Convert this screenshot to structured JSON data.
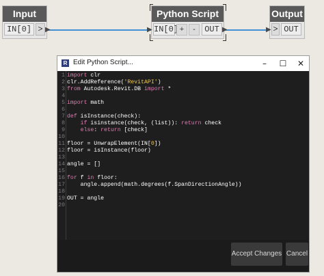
{
  "nodes": {
    "input": {
      "title": "Input",
      "port_label": "IN[0]",
      "port_chevron": ">"
    },
    "python": {
      "title": "Python Script",
      "in_port": "IN[0]",
      "add": "+",
      "remove": "-",
      "out_port": "OUT"
    },
    "output": {
      "title": "Output",
      "in_chevron": ">",
      "out_port": "OUT"
    }
  },
  "dialog": {
    "title": "Edit Python Script...",
    "app_icon": "R",
    "minimize": "–",
    "maximize": "☐",
    "close": "✕",
    "accept_label": "Accept Changes",
    "cancel_label": "Cancel"
  },
  "editor": {
    "line_numbers": [
      "1",
      "2",
      "3",
      "4",
      "5",
      "6",
      "7",
      "8",
      "9",
      "10",
      "11",
      "12",
      "13",
      "14",
      "15",
      "16",
      "17",
      "18",
      "19",
      "20"
    ],
    "lines": [
      [
        {
          "t": "import",
          "c": "kw"
        },
        {
          "t": " clr",
          "c": "fn"
        }
      ],
      [
        {
          "t": "clr.AddReference(",
          "c": "fn"
        },
        {
          "t": "'RevitAPI'",
          "c": "str"
        },
        {
          "t": ")",
          "c": "fn"
        }
      ],
      [
        {
          "t": "from",
          "c": "kw"
        },
        {
          "t": " Autodesk.Revit.DB ",
          "c": "fn"
        },
        {
          "t": "import",
          "c": "kw"
        },
        {
          "t": " *",
          "c": "fn"
        }
      ],
      [],
      [
        {
          "t": "import",
          "c": "kw"
        },
        {
          "t": " math",
          "c": "fn"
        }
      ],
      [],
      [
        {
          "t": "def",
          "c": "kw"
        },
        {
          "t": " isInstance(check):",
          "c": "fn"
        }
      ],
      [
        {
          "t": "    if",
          "c": "kw"
        },
        {
          "t": " isinstance(check, (list)): ",
          "c": "fn"
        },
        {
          "t": "return",
          "c": "kw"
        },
        {
          "t": " check",
          "c": "fn"
        }
      ],
      [
        {
          "t": "    else",
          "c": "kw"
        },
        {
          "t": ": ",
          "c": "fn"
        },
        {
          "t": "return",
          "c": "kw"
        },
        {
          "t": " [check]",
          "c": "fn"
        }
      ],
      [],
      [
        {
          "t": "floor = UnwrapElement(IN[",
          "c": "fn"
        },
        {
          "t": "0",
          "c": "str"
        },
        {
          "t": "])",
          "c": "fn"
        }
      ],
      [
        {
          "t": "floor = isInstance(floor)",
          "c": "fn"
        }
      ],
      [],
      [
        {
          "t": "angle = []",
          "c": "fn"
        }
      ],
      [],
      [
        {
          "t": "for",
          "c": "kw"
        },
        {
          "t": " f ",
          "c": "fn"
        },
        {
          "t": "in",
          "c": "kw"
        },
        {
          "t": " floor:",
          "c": "fn"
        }
      ],
      [
        {
          "t": "    angle.append(math.degrees(f.SpanDirectionAngle))",
          "c": "fn"
        }
      ],
      [],
      [
        {
          "t": "OUT = angle",
          "c": "fn"
        }
      ],
      []
    ]
  },
  "colors": {
    "wire": "#3f8fd2",
    "node_header": "#595959",
    "editor_bg": "#1e1e1e",
    "keyword": "#dd7eb2",
    "string": "#f2c84b"
  },
  "icons": {
    "app": "revit-icon",
    "minimize": "minimize-icon",
    "maximize": "maximize-icon",
    "close": "close-icon"
  }
}
